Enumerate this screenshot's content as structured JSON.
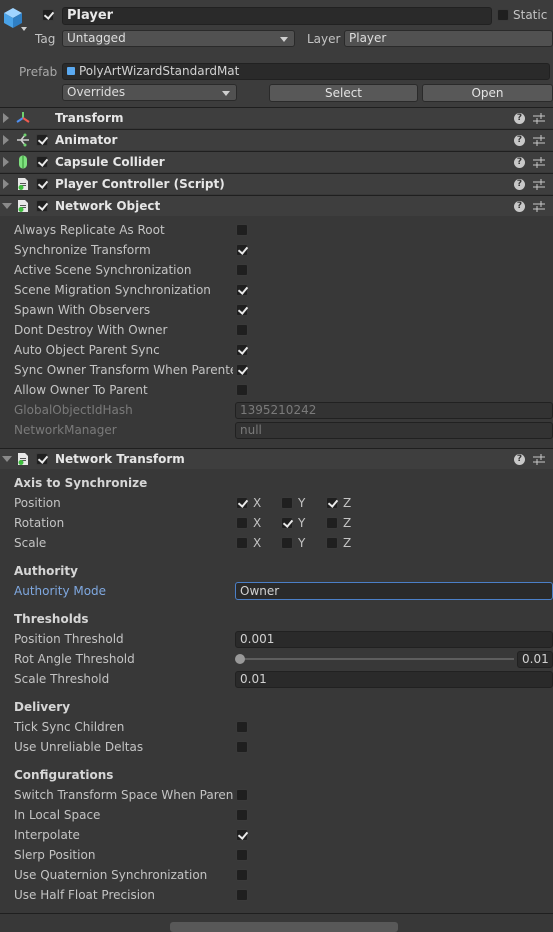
{
  "header": {
    "name": "Player",
    "active_checked": true,
    "static_label": "Static",
    "static_checked": false,
    "tag_label": "Tag",
    "tag_value": "Untagged",
    "layer_label": "Layer",
    "layer_value": "Player",
    "prefab_label": "Prefab",
    "prefab_value": "PolyArtWizardStandardMat",
    "overrides_value": "Overrides",
    "select_label": "Select",
    "open_label": "Open"
  },
  "components": [
    {
      "title": "Transform",
      "icon": "transform-icon",
      "has_checkbox": false
    },
    {
      "title": "Animator",
      "icon": "animator-icon",
      "has_checkbox": true,
      "checked": true
    },
    {
      "title": "Capsule Collider",
      "icon": "capsule-collider-icon",
      "has_checkbox": true,
      "checked": true
    },
    {
      "title": "Player Controller (Script)",
      "icon": "script-icon",
      "has_checkbox": true,
      "checked": true
    },
    {
      "title": "Network Object",
      "icon": "script-icon",
      "has_checkbox": true,
      "checked": true
    }
  ],
  "network_object": {
    "fields": [
      {
        "label": "Always Replicate As Root",
        "checked": false
      },
      {
        "label": "Synchronize Transform",
        "checked": true
      },
      {
        "label": "Active Scene Synchronization",
        "checked": false
      },
      {
        "label": "Scene Migration Synchronization",
        "checked": true
      },
      {
        "label": "Spawn With Observers",
        "checked": true
      },
      {
        "label": "Dont Destroy With Owner",
        "checked": false
      },
      {
        "label": "Auto Object Parent Sync",
        "checked": true
      },
      {
        "label": "Sync Owner Transform When Parented",
        "checked": true
      },
      {
        "label": "Allow Owner To Parent",
        "checked": false
      }
    ],
    "global_hash_label": "GlobalObjectIdHash",
    "global_hash_value": "1395210242",
    "network_manager_label": "NetworkManager",
    "network_manager_value": "null"
  },
  "network_transform": {
    "title": "Network Transform",
    "checked": true,
    "axis_header": "Axis to Synchronize",
    "axes": [
      {
        "label": "Position",
        "x": true,
        "y": false,
        "z": true
      },
      {
        "label": "Rotation",
        "x": false,
        "y": true,
        "z": false
      },
      {
        "label": "Scale",
        "x": false,
        "y": false,
        "z": false
      }
    ],
    "axis_letters": [
      "X",
      "Y",
      "Z"
    ],
    "authority_header": "Authority",
    "authority_mode_label": "Authority Mode",
    "authority_mode_value": "Owner",
    "thresholds_header": "Thresholds",
    "position_threshold_label": "Position Threshold",
    "position_threshold_value": "0.001",
    "rot_angle_label": "Rot Angle Threshold",
    "rot_angle_value": "0.01",
    "scale_threshold_label": "Scale Threshold",
    "scale_threshold_value": "0.01",
    "delivery_header": "Delivery",
    "delivery_fields": [
      {
        "label": "Tick Sync Children",
        "checked": false
      },
      {
        "label": "Use Unreliable Deltas",
        "checked": false
      }
    ],
    "config_header": "Configurations",
    "config_fields": [
      {
        "label": "Switch Transform Space When Parented",
        "checked": false
      },
      {
        "label": "In Local Space",
        "checked": false
      },
      {
        "label": "Interpolate",
        "checked": true
      },
      {
        "label": "Slerp Position",
        "checked": false
      },
      {
        "label": "Use Quaternion Synchronization",
        "checked": false
      },
      {
        "label": "Use Half Float Precision",
        "checked": false
      }
    ]
  },
  "colors": {
    "background": "#383838",
    "accent_blue": "#7fa8e0",
    "component_header": "#3e3e3e"
  }
}
